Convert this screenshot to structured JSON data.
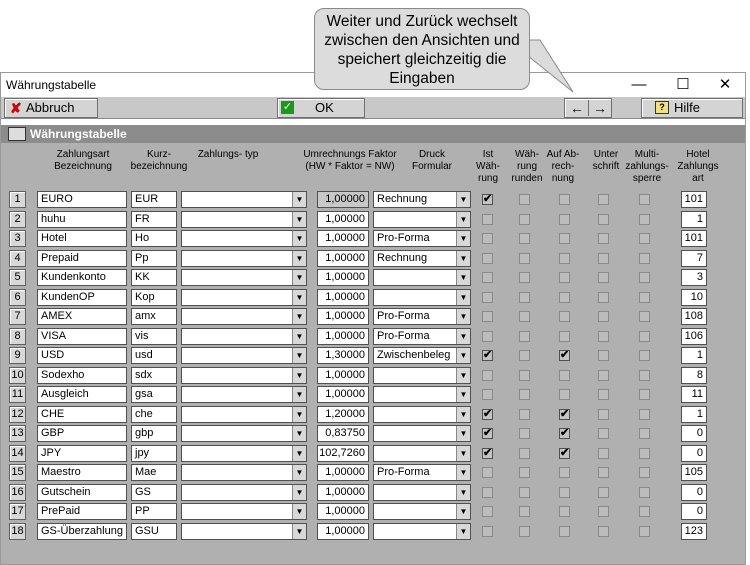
{
  "window": {
    "title": "Währungstabelle",
    "minimize": "—",
    "maximize": "☐",
    "close": "✕"
  },
  "callout": {
    "text": "Weiter und Zurück wechselt zwischen den Ansichten und speichert gleichzeitig die Eingaben"
  },
  "toolbar": {
    "cancel_label": "Abbruch",
    "ok_label": "OK",
    "help_label": "Hilfe",
    "prev": "←",
    "next": "→"
  },
  "panel": {
    "title": "Währungstabelle"
  },
  "columns": {
    "zahlungsart": "Zahlungsart Bezeichnung",
    "kurz": "Kurz- bezeichnung",
    "typ": "Zahlungs- typ",
    "faktor": "Umrechnungs Faktor (HW * Faktor = NW)",
    "druck": "Druck Formular",
    "istw": "Ist Wäh- rung",
    "runden": "Wäh- rung runden",
    "abrech": "Auf Ab- rech- nung",
    "unter": "Unter schrift",
    "multi": "Multi- zahlungs- sperre",
    "hotel": "Hotel Zahlungs art"
  },
  "rows": [
    {
      "n": "1",
      "name": "EURO",
      "kurz": "EUR",
      "typ": "",
      "faktor": "1,00000",
      "druck": "Rechnung",
      "istw": true,
      "runden": false,
      "abrech": false,
      "unter": false,
      "multi": false,
      "hotel": "101",
      "faktor_disabled": true
    },
    {
      "n": "2",
      "name": "huhu",
      "kurz": "FR",
      "typ": "",
      "faktor": "1,00000",
      "druck": "",
      "istw": false,
      "runden": false,
      "abrech": false,
      "unter": false,
      "multi": false,
      "hotel": "1"
    },
    {
      "n": "3",
      "name": "Hotel",
      "kurz": "Ho",
      "typ": "",
      "faktor": "1,00000",
      "druck": "Pro-Forma",
      "istw": false,
      "runden": false,
      "abrech": false,
      "unter": false,
      "multi": false,
      "hotel": "101"
    },
    {
      "n": "4",
      "name": "Prepaid",
      "kurz": "Pp",
      "typ": "",
      "faktor": "1,00000",
      "druck": "Rechnung",
      "istw": false,
      "runden": false,
      "abrech": false,
      "unter": false,
      "multi": false,
      "hotel": "7"
    },
    {
      "n": "5",
      "name": "Kundenkonto",
      "kurz": "KK",
      "typ": "",
      "faktor": "1,00000",
      "druck": "",
      "istw": false,
      "runden": false,
      "abrech": false,
      "unter": false,
      "multi": false,
      "hotel": "3"
    },
    {
      "n": "6",
      "name": "KundenOP",
      "kurz": "Kop",
      "typ": "",
      "faktor": "1,00000",
      "druck": "",
      "istw": false,
      "runden": false,
      "abrech": false,
      "unter": false,
      "multi": false,
      "hotel": "10"
    },
    {
      "n": "7",
      "name": "AMEX",
      "kurz": "amx",
      "typ": "",
      "faktor": "1,00000",
      "druck": "Pro-Forma",
      "istw": false,
      "runden": false,
      "abrech": false,
      "unter": false,
      "multi": false,
      "hotel": "108"
    },
    {
      "n": "8",
      "name": "VISA",
      "kurz": "vis",
      "typ": "",
      "faktor": "1,00000",
      "druck": "Pro-Forma",
      "istw": false,
      "runden": false,
      "abrech": false,
      "unter": false,
      "multi": false,
      "hotel": "106"
    },
    {
      "n": "9",
      "name": "USD",
      "kurz": "usd",
      "typ": "",
      "faktor": "1,30000",
      "druck": "Zwischenbeleg",
      "istw": true,
      "runden": false,
      "abrech": true,
      "unter": false,
      "multi": false,
      "hotel": "1"
    },
    {
      "n": "10",
      "name": "Sodexho",
      "kurz": "sdx",
      "typ": "",
      "faktor": "1,00000",
      "druck": "",
      "istw": false,
      "runden": false,
      "abrech": false,
      "unter": false,
      "multi": false,
      "hotel": "8"
    },
    {
      "n": "11",
      "name": "Ausgleich",
      "kurz": "gsa",
      "typ": "",
      "faktor": "1,00000",
      "druck": "",
      "istw": false,
      "runden": false,
      "abrech": false,
      "unter": false,
      "multi": false,
      "hotel": "11"
    },
    {
      "n": "12",
      "name": "CHE",
      "kurz": "che",
      "typ": "",
      "faktor": "1,20000",
      "druck": "",
      "istw": true,
      "runden": false,
      "abrech": true,
      "unter": false,
      "multi": false,
      "hotel": "1"
    },
    {
      "n": "13",
      "name": "GBP",
      "kurz": "gbp",
      "typ": "",
      "faktor": "0,83750",
      "druck": "",
      "istw": true,
      "runden": false,
      "abrech": true,
      "unter": false,
      "multi": false,
      "hotel": "0"
    },
    {
      "n": "14",
      "name": "JPY",
      "kurz": "jpy",
      "typ": "",
      "faktor": "102,7260",
      "druck": "",
      "istw": true,
      "runden": false,
      "abrech": true,
      "unter": false,
      "multi": false,
      "hotel": "0"
    },
    {
      "n": "15",
      "name": "Maestro",
      "kurz": "Mae",
      "typ": "",
      "faktor": "1,00000",
      "druck": "Pro-Forma",
      "istw": false,
      "runden": false,
      "abrech": false,
      "unter": false,
      "multi": false,
      "hotel": "105"
    },
    {
      "n": "16",
      "name": "Gutschein",
      "kurz": "GS",
      "typ": "",
      "faktor": "1,00000",
      "druck": "",
      "istw": false,
      "runden": false,
      "abrech": false,
      "unter": false,
      "multi": false,
      "hotel": "0"
    },
    {
      "n": "17",
      "name": "PrePaid",
      "kurz": "PP",
      "typ": "",
      "faktor": "1,00000",
      "druck": "",
      "istw": false,
      "runden": false,
      "abrech": false,
      "unter": false,
      "multi": false,
      "hotel": "0"
    },
    {
      "n": "18",
      "name": "GS-Überzahlung",
      "kurz": "GSU",
      "typ": "",
      "faktor": "1,00000",
      "druck": "",
      "istw": false,
      "runden": false,
      "abrech": false,
      "unter": false,
      "multi": false,
      "hotel": "123"
    }
  ],
  "colors": {
    "toolbar_bg": "#c8c8c8",
    "header_bar": "#8c8c8c",
    "grid_bg": "#b0b0b0",
    "cancel_icon": "#d00000",
    "ok_icon": "#1a9a1a"
  }
}
